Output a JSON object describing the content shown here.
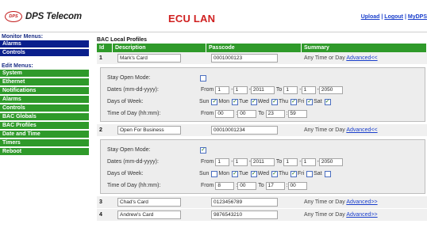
{
  "header": {
    "logo_badge": "DPS",
    "logo_text": "DPS Telecom",
    "app_title": "ECU LAN",
    "links": [
      "Upload",
      "Logout",
      "MyDPS"
    ]
  },
  "sidebar": {
    "monitor_heading": "Monitor Menus:",
    "monitor_items": [
      "Alarms",
      "Controls"
    ],
    "edit_heading": "Edit Menus:",
    "edit_items": [
      "System",
      "Ethernet",
      "Notifications",
      "Alarms",
      "Controls",
      "BAC Globals",
      "BAC Profiles",
      "Date and Time",
      "Timers",
      "Reboot"
    ]
  },
  "main": {
    "section_title": "BAC Local Profiles",
    "columns": {
      "id": "Id",
      "description": "Description",
      "passcode": "Passcode",
      "summary": "Summary"
    },
    "labels": {
      "stay_open": "Stay Open Mode:",
      "dates": "Dates (mm-dd-yyyy):",
      "days": "Days of Week:",
      "time": "Time of Day (hh:mm):",
      "from": "From",
      "to": "To",
      "sun": "Sun",
      "mon": "Mon",
      "tue": "Tue",
      "wed": "Wed",
      "thu": "Thu",
      "fri": "Fri",
      "sat": "Sat"
    },
    "profiles": [
      {
        "id": "1",
        "description": "Mark's Card",
        "passcode": "0001000123",
        "summary": "Any Time or Day",
        "link": "Advanced<<",
        "detail": {
          "stay_open": false,
          "date_from": [
            "1",
            "1",
            "2011"
          ],
          "date_to": [
            "1",
            "1",
            "2050"
          ],
          "days": {
            "sun": false,
            "mon": true,
            "tue": true,
            "wed": true,
            "thu": true,
            "fri": true,
            "sat": true
          },
          "time_from": [
            "00",
            "00"
          ],
          "time_to": [
            "23",
            "59"
          ]
        }
      },
      {
        "id": "2",
        "description": "Open For Business",
        "passcode": "00010001234",
        "summary": "Any Time or Day",
        "link": "Advanced<<",
        "detail": {
          "stay_open": true,
          "date_from": [
            "1",
            "1",
            "2011"
          ],
          "date_to": [
            "1",
            "1",
            "2050"
          ],
          "days": {
            "sun": false,
            "mon": false,
            "tue": true,
            "wed": true,
            "thu": true,
            "fri": true,
            "sat": false
          },
          "time_from": [
            "8",
            "00"
          ],
          "time_to": [
            "17",
            "00"
          ]
        }
      },
      {
        "id": "3",
        "description": "Chad's Card",
        "passcode": "0123456789",
        "summary": "Any Time or Day",
        "link": "Advanced>>"
      },
      {
        "id": "4",
        "description": "Andrew's Card",
        "passcode": "9876543210",
        "summary": "Any Time or Day",
        "link": "Advanced>>"
      }
    ],
    "check_glyph": "✓"
  }
}
